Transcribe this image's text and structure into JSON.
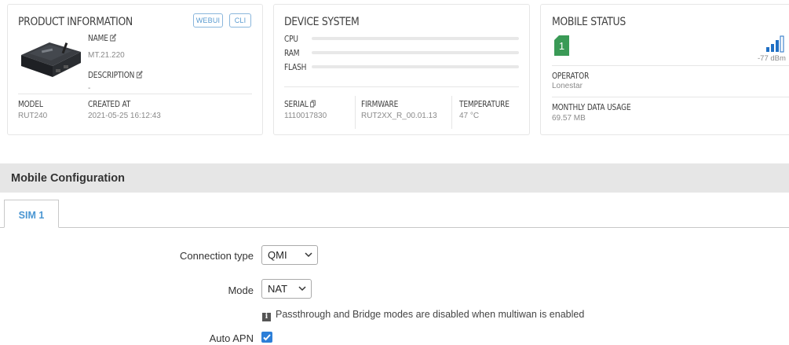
{
  "product": {
    "title": "PRODUCT INFORMATION",
    "webui_label": "WEBUI",
    "cli_label": "CLI",
    "name_label": "NAME",
    "name_value": "MT.21.220",
    "description_label": "DESCRIPTION",
    "description_value": "-",
    "model_label": "MODEL",
    "model_value": "RUT240",
    "created_label": "CREATED AT",
    "created_value": "2021-05-25 16:12:43"
  },
  "device": {
    "title": "DEVICE SYSTEM",
    "cpu_label": "CPU",
    "ram_label": "RAM",
    "flash_label": "FLASH",
    "serial_label": "SERIAL",
    "serial_value": "1110017830",
    "firmware_label": "FIRMWARE",
    "firmware_value": "RUT2XX_R_00.01.13",
    "temperature_label": "TEMPERATURE",
    "temperature_value": "47 °C"
  },
  "mobile": {
    "title": "MOBILE STATUS",
    "sim_number": "1",
    "signal": "-77 dBm",
    "operator_label": "OPERATOR",
    "operator_value": "Lonestar",
    "usage_label": "MONTHLY DATA USAGE",
    "usage_value": "69.57 MB"
  },
  "config": {
    "section_title": "Mobile Configuration",
    "tab_sim1": "SIM 1",
    "connection_type_label": "Connection type",
    "connection_type_value": "QMI",
    "mode_label": "Mode",
    "mode_value": "NAT",
    "mode_hint": "Passthrough and Bridge modes are disabled when multiwan is enabled",
    "info_icon_glyph": "i",
    "auto_apn_label": "Auto APN",
    "auto_apn_checked": true
  },
  "colors": {
    "accent": "#2d7fd8",
    "sim_green": "#3a9a56",
    "signal_blue": "#1f6fc4"
  }
}
